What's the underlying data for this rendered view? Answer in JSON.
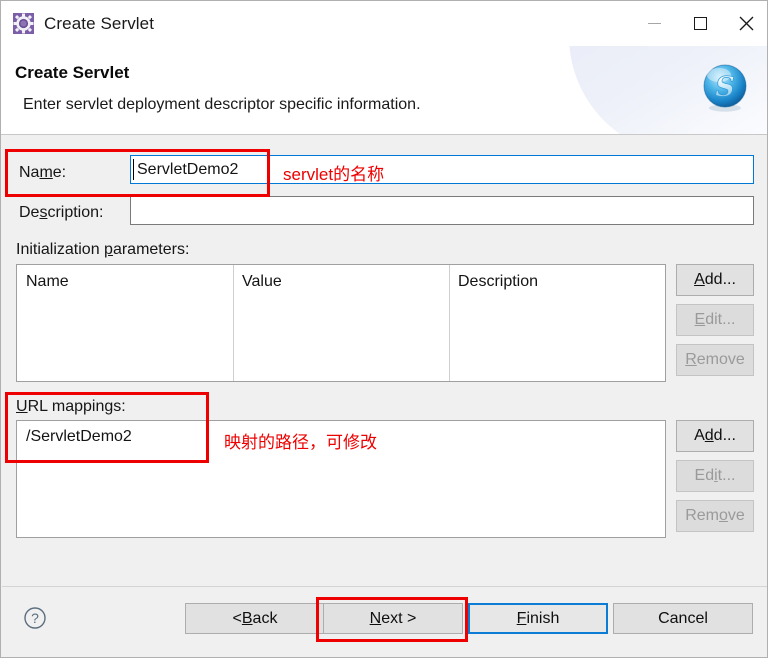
{
  "window": {
    "title": "Create Servlet",
    "icon": "servlet-gear-icon",
    "controls": {
      "minimize": "minimize-icon",
      "maximize": "maximize-icon",
      "close": "close-icon"
    }
  },
  "banner": {
    "title": "Create Servlet",
    "description": "Enter servlet deployment descriptor specific information.",
    "logo": "spring-s-sphere-logo"
  },
  "form": {
    "name": {
      "label_pre": "Na",
      "label_mn": "m",
      "label_post": "e:",
      "value": "ServletDemo2",
      "placeholder": ""
    },
    "description": {
      "label_pre": "De",
      "label_mn": "s",
      "label_post": "cription:",
      "value": "",
      "placeholder": ""
    }
  },
  "init_params": {
    "label_pre": "Initialization ",
    "label_mn": "p",
    "label_post": "arameters:",
    "columns": [
      "Name",
      "Value",
      "Description"
    ],
    "rows": [],
    "buttons": [
      {
        "pre": "",
        "mn": "A",
        "post": "dd...",
        "enabled": true
      },
      {
        "pre": "",
        "mn": "E",
        "post": "dit...",
        "enabled": false
      },
      {
        "pre": "",
        "mn": "R",
        "post": "emove",
        "enabled": false
      }
    ]
  },
  "url_mappings": {
    "label_mn": "U",
    "label_post": "RL mappings:",
    "rows": [
      "/ServletDemo2"
    ],
    "buttons": [
      {
        "pre": "A",
        "mn": "d",
        "post": "d...",
        "enabled": true
      },
      {
        "pre": "Ed",
        "mn": "i",
        "post": "t...",
        "enabled": false
      },
      {
        "pre": "Rem",
        "mn": "o",
        "post": "ve",
        "enabled": false
      }
    ]
  },
  "annotations": {
    "name_note": "servlet的名称",
    "url_note": "映射的路径，可修改"
  },
  "footer": {
    "help": "help-icon",
    "buttons": [
      {
        "pre": "< ",
        "mn": "B",
        "post": "ack"
      },
      {
        "pre": "",
        "mn": "N",
        "post": "ext >"
      },
      {
        "pre": "",
        "mn": "F",
        "post": "inish"
      },
      {
        "pre": "Cancel",
        "mn": "",
        "post": ""
      }
    ]
  },
  "colors": {
    "highlight": "#ee0000",
    "focus": "#0078d7",
    "default_button": "#0c7cd5",
    "dialog_bg": "#f0f0f0"
  }
}
